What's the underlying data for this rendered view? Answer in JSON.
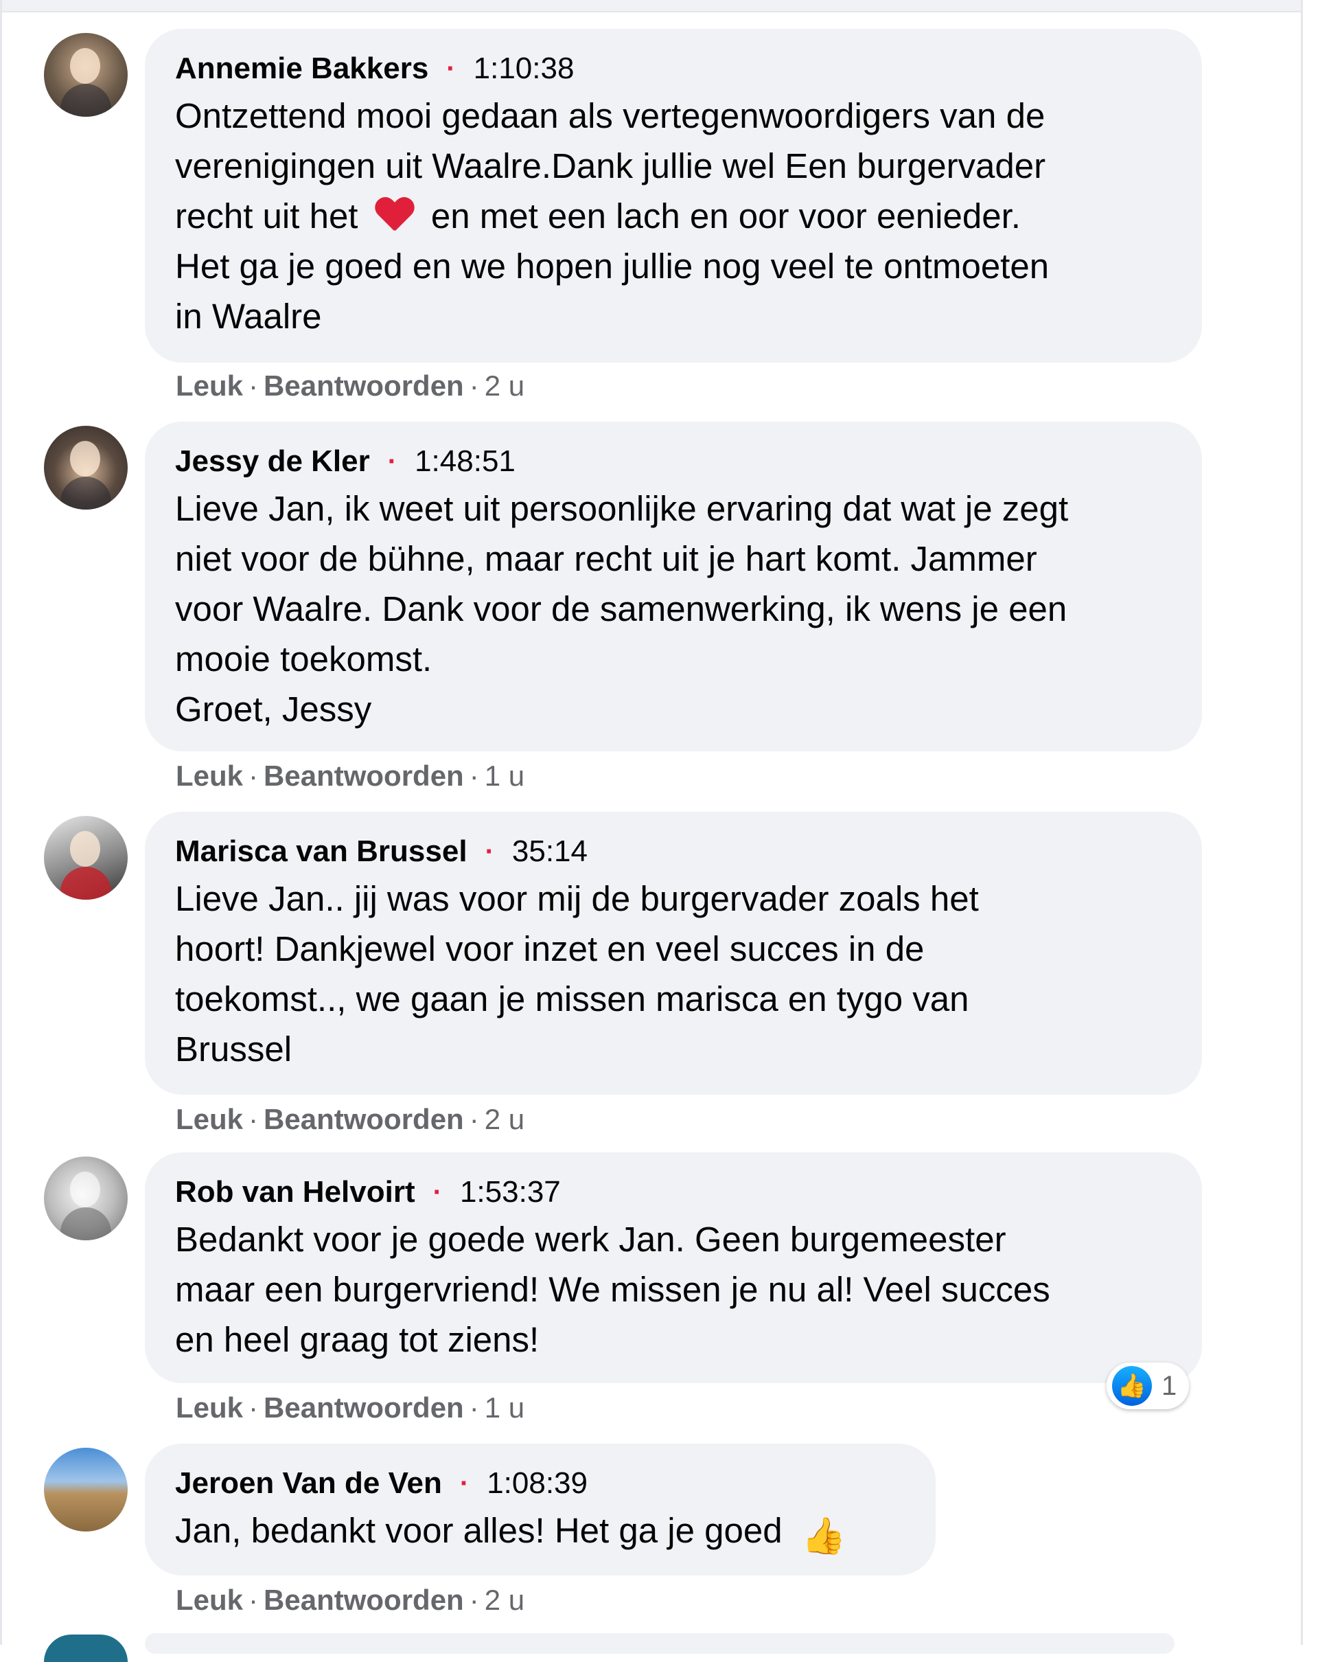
{
  "comments": [
    {
      "author": "Annemie Bakkers",
      "timecode": "1:10:38",
      "text_parts": [
        "Ontzettend mooi gedaan als vertegenwoordigers van de\nverenigingen uit Waalre.Dank jullie wel Een burgervader\nrecht uit het ",
        " en met een lach en oor voor eenieder.\nHet ga je goed en we hopen jullie nog veel te ontmoeten\nin Waalre"
      ],
      "emoji": "red-heart",
      "like_label": "Leuk",
      "reply_label": "Beantwoorden",
      "age": "2 u",
      "avatar_color": "#6b5b4a"
    },
    {
      "author": "Jessy de Kler",
      "timecode": "1:48:51",
      "text": "Lieve Jan, ik weet uit persoonlijke ervaring dat wat je zegt\nniet voor de bühne, maar recht uit je hart komt. Jammer\nvoor Waalre. Dank voor de samenwerking, ik wens je een\nmooie toekomst.\nGroet, Jessy",
      "like_label": "Leuk",
      "reply_label": "Beantwoorden",
      "age": "1 u",
      "avatar_color": "#3f3a36"
    },
    {
      "author": "Marisca van Brussel",
      "timecode": "35:14",
      "text": "Lieve Jan.. jij was voor mij de burgervader zoals het\nhoort! Dankjewel voor inzet en veel succes in de\ntoekomst.., we gaan je missen marisca en tygo van\nBrussel",
      "like_label": "Leuk",
      "reply_label": "Beantwoorden",
      "age": "2 u",
      "avatar_color": "#8a8a8a"
    },
    {
      "author": "Rob van Helvoirt",
      "timecode": "1:53:37",
      "text": "Bedankt voor je goede werk Jan. Geen burgemeester\nmaar een burgervriend! We missen je nu al! Veel succes\nen heel graag tot ziens!",
      "like_label": "Leuk",
      "reply_label": "Beantwoorden",
      "age": "1 u",
      "reaction_count": "1",
      "avatar_color": "#bdbdbd"
    },
    {
      "author": "Jeroen Van de Ven",
      "timecode": "1:08:39",
      "text": "Jan, bedankt voor alles! Het ga je goed ",
      "emoji": "thumbs-up",
      "like_label": "Leuk",
      "reply_label": "Beantwoorden",
      "age": "2 u",
      "avatar_color": "#9a7a55"
    }
  ],
  "separator": "·"
}
